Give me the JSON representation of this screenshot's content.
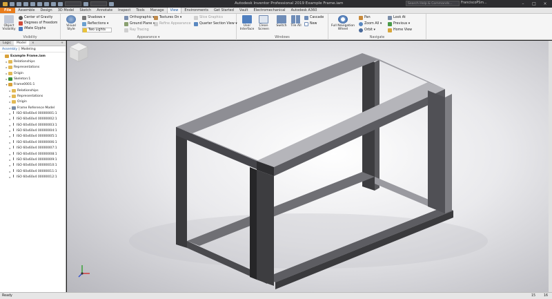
{
  "app": {
    "title": "Autodesk Inventor Professional 2019    Example Frame.iam",
    "help_placeholder": "Search Help & Commands...",
    "user": "FranciscoPSm...",
    "window_buttons": [
      "–",
      "□",
      "×"
    ]
  },
  "tabs": [
    "File",
    "Assemble",
    "Design",
    "3D Model",
    "Sketch",
    "Annotate",
    "Inspect",
    "Tools",
    "Manage",
    "View",
    "Environments",
    "Get Started",
    "Vault",
    "Electromechanical",
    "Autodesk A360"
  ],
  "active_tab": "View",
  "ribbon": {
    "visibility": {
      "title": "Visibility",
      "object_visibility": "Object Visibility",
      "center_of_gravity": "Center of Gravity",
      "degrees_of_freedom": "Degrees of Freedom",
      "imate_glyphs": "iMate Glyphs"
    },
    "appearance": {
      "title": "Appearance ▾",
      "visual_style": "Visual Style",
      "shadows": "Shadows ▾",
      "reflections": "Reflections ▾",
      "two_lights": "Two Lights",
      "orthographic": "Orthographic ▾",
      "ground_plane": "Ground Plane ▾",
      "ray_tracing": "Ray Tracing",
      "textures_on": "Textures On ▾",
      "refine_appearance": "Refine Appearance",
      "slice_graphics": "Slice Graphics",
      "quarter_section_view": "Quarter Section View ▾"
    },
    "windows": {
      "title": "Windows",
      "user_interface": "User Interface",
      "clean_screen": "Clean Screen",
      "switch": "Switch",
      "tile_all": "Tile All",
      "cascade": "Cascade",
      "new": "New"
    },
    "navigate": {
      "title": "Navigate",
      "full_navigation_wheel": "Full Navigation Wheel",
      "pan": "Pan",
      "zoom_all": "Zoom All ▾",
      "orbit": "Orbit ▾",
      "look_at": "Look At",
      "previous": "Previous ▾",
      "home_view": "Home View"
    }
  },
  "browser": {
    "tabs": [
      "Logic",
      "Model",
      "×",
      "+"
    ],
    "mode_links": [
      "Assembly",
      "|",
      "Modeling"
    ],
    "tree": [
      {
        "label": "Example Frame.iam",
        "icon": "asm",
        "indent": 0,
        "root": true
      },
      {
        "label": "Relationships",
        "icon": "folder",
        "indent": 1
      },
      {
        "label": "Representations",
        "icon": "folder",
        "indent": 1
      },
      {
        "label": "Origin",
        "icon": "folder",
        "indent": 1
      },
      {
        "label": "Skeleton:1",
        "icon": "sk",
        "indent": 1
      },
      {
        "label": "Frame0001:1",
        "icon": "asm",
        "indent": 1,
        "expanded": true
      },
      {
        "label": "Relationships",
        "icon": "folder",
        "indent": 2
      },
      {
        "label": "Representations",
        "icon": "folder",
        "indent": 2
      },
      {
        "label": "Origin",
        "icon": "folder",
        "indent": 2
      },
      {
        "label": "Frame Reference Model",
        "icon": "part",
        "indent": 2
      },
      {
        "label": "ISO 60x60x4 00000001:1",
        "icon": "ibeam",
        "indent": 2
      },
      {
        "label": "ISO 60x60x4 00000002:1",
        "icon": "ibeam",
        "indent": 2
      },
      {
        "label": "ISO 60x60x4 00000003:1",
        "icon": "ibeam",
        "indent": 2
      },
      {
        "label": "ISO 60x60x4 00000004:1",
        "icon": "ibeam",
        "indent": 2
      },
      {
        "label": "ISO 60x60x4 00000005:1",
        "icon": "ibeam",
        "indent": 2
      },
      {
        "label": "ISO 60x60x4 00000006:1",
        "icon": "ibeam",
        "indent": 2
      },
      {
        "label": "ISO 60x60x4 00000007:1",
        "icon": "ibeam",
        "indent": 2
      },
      {
        "label": "ISO 60x60x4 00000008:1",
        "icon": "ibeam",
        "indent": 2
      },
      {
        "label": "ISO 60x60x4 00000009:1",
        "icon": "ibeam",
        "indent": 2
      },
      {
        "label": "ISO 60x60x4 00000010:1",
        "icon": "ibeam",
        "indent": 2
      },
      {
        "label": "ISO 60x60x4 00000011:1",
        "icon": "ibeam",
        "indent": 2
      },
      {
        "label": "ISO 60x60x4 00000012:1",
        "icon": "ibeam",
        "indent": 2
      }
    ]
  },
  "status": {
    "text": "Ready",
    "n1": "15",
    "n2": "16"
  },
  "colors": {
    "file_tab": "#e97c1c",
    "accent": "#1a5aa6",
    "frame_dark": "#3a3a3d",
    "frame_light": "#8c8c90"
  }
}
